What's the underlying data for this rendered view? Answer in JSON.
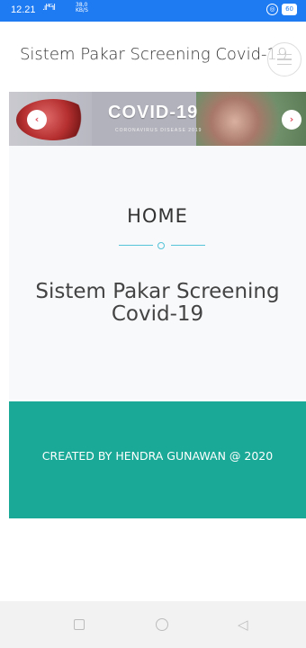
{
  "status_bar": {
    "time": "12.21",
    "signal": ".ıl⁴ᴳıl",
    "net_speed_value": "38,0",
    "net_speed_unit": "KB/S",
    "battery": "60"
  },
  "header": {
    "brand": "Sistem Pakar Screening Covid-19",
    "menu_icon": "hamburger-menu-icon"
  },
  "slider": {
    "logo_text": "COVID-19",
    "logo_subtext": "CORONAVIRUS DISEASE 2019",
    "prev_icon": "chevron-left-icon",
    "next_icon": "chevron-right-icon"
  },
  "home": {
    "title": "HOME",
    "subtitle": "Sistem Pakar Screening Covid-19"
  },
  "footer": {
    "text": "CREATED BY HENDRA GUNAWAN @ 2020"
  },
  "colors": {
    "status_bar": "#1f7bf2",
    "accent": "#55c3d8",
    "footer": "#19a996",
    "arrow": "#e05260"
  }
}
